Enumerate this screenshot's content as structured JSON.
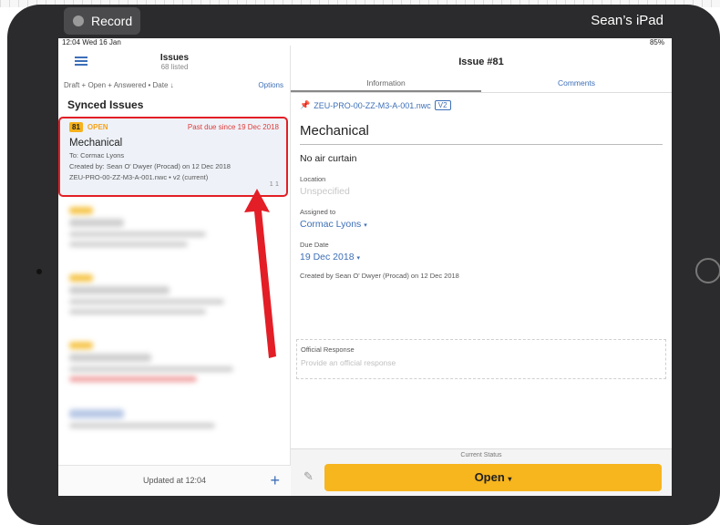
{
  "recorder": {
    "label": "Record",
    "device": "Sean’s iPad"
  },
  "status_bar": {
    "time_date": "12:04  Wed 16 Jan",
    "battery": "85%"
  },
  "list": {
    "title": "Issues",
    "count": "68 listed",
    "filter": "Draft + Open + Answered • Date ↓",
    "options": "Options",
    "section": "Synced Issues",
    "selected_issue": {
      "number": "81",
      "status": "OPEN",
      "due": "Past due since 19 Dec 2018",
      "title": "Mechanical",
      "to": "To: Cormac Lyons",
      "created": "Created by: Sean O' Dwyer (Procad) on 12 Dec 2018",
      "file": "ZEU-PRO-00-ZZ-M3-A-001.nwc • v2 (current)",
      "meta": "1   1"
    },
    "footer": {
      "updated": "Updated at 12:04",
      "add": "+"
    }
  },
  "detail": {
    "title": "Issue #81",
    "tabs": [
      "Information",
      "Comments"
    ],
    "file_name": "ZEU-PRO-00-ZZ-M3-A-001.nwc",
    "version": "V2",
    "issue_title": "Mechanical",
    "description": "No air curtain",
    "location_label": "Location",
    "location_value": "Unspecified",
    "assigned_label": "Assigned to",
    "assigned_value": "Cormac Lyons",
    "due_label": "Due Date",
    "due_value": "19 Dec 2018",
    "created": "Created by Sean O' Dwyer (Procad) on 12 Dec 2018",
    "official_label": "Official Response",
    "official_placeholder": "Provide an official response",
    "current_status_label": "Current Status",
    "status_button": "Open"
  },
  "colors": {
    "accent": "#3d6fb8",
    "status_open": "#f7b51e",
    "alert": "#e31e26"
  }
}
